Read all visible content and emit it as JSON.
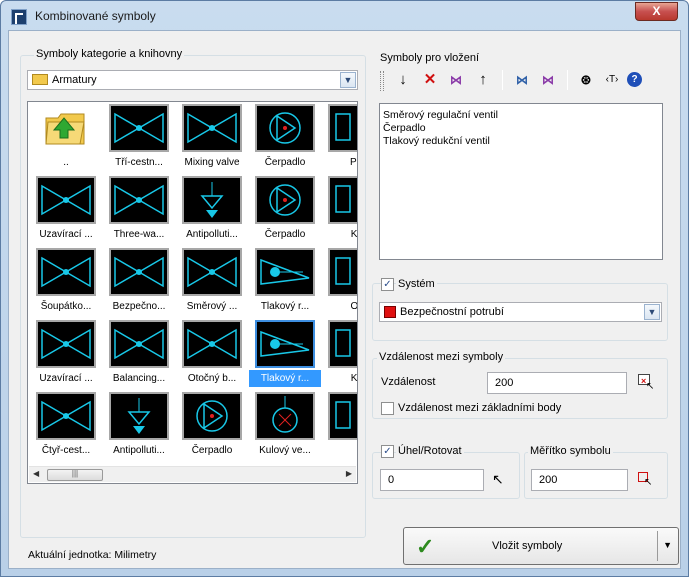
{
  "window": {
    "title": "Kombinované symboly",
    "close_label": "X"
  },
  "library": {
    "group_label": "Symboly kategorie a knihovny",
    "category_value": "Armatury",
    "items": [
      {
        "label": "..",
        "icon": "folder-up-icon"
      },
      {
        "label": "Tří-cestn...",
        "icon": "three-way-valve-icon"
      },
      {
        "label": "Mixing valve",
        "icon": "mixing-valve-icon"
      },
      {
        "label": "Čerpadlo",
        "icon": "pump-icon"
      },
      {
        "label": "Přír",
        "icon": "symbol-icon"
      },
      {
        "label": "Uzavírací ...",
        "icon": "shutoff-valve-icon"
      },
      {
        "label": "Three-wa...",
        "icon": "three-way-valve-icon"
      },
      {
        "label": "Antipolluti...",
        "icon": "antipollution-valve-icon"
      },
      {
        "label": "Čerpadlo",
        "icon": "pump-icon"
      },
      {
        "label": "Kul",
        "icon": "symbol-icon"
      },
      {
        "label": "Šoupátko...",
        "icon": "gate-valve-icon"
      },
      {
        "label": "Bezpečno...",
        "icon": "safety-valve-icon"
      },
      {
        "label": "Směrový ...",
        "icon": "directional-valve-icon"
      },
      {
        "label": "Tlakový r...",
        "icon": "pressure-valve-icon"
      },
      {
        "label": "Ovl",
        "icon": "symbol-icon"
      },
      {
        "label": "Uzavírací ...",
        "icon": "shutoff-valve-icon"
      },
      {
        "label": "Balancing...",
        "icon": "balancing-valve-icon"
      },
      {
        "label": "Otočný b...",
        "icon": "rotary-valve-icon"
      },
      {
        "label": "Tlakový r...",
        "icon": "pressure-valve-icon"
      },
      {
        "label": "Kal",
        "icon": "symbol-icon"
      },
      {
        "label": "Čtyř-cest...",
        "icon": "four-way-valve-icon"
      },
      {
        "label": "Antipolluti...",
        "icon": "antipollution-valve-icon"
      },
      {
        "label": "Čerpadlo",
        "icon": "pump-icon"
      },
      {
        "label": "Kulový ve...",
        "icon": "ball-valve-icon"
      },
      {
        "label": "",
        "icon": "symbol-icon"
      }
    ],
    "selected_index": 18
  },
  "insert": {
    "group_label": "Symboly pro vložení",
    "items": [
      "Směrový regulační ventil",
      "Čerpadlo",
      "Tlakový redukční ventil"
    ]
  },
  "system": {
    "checkbox_label": "Systém",
    "checked": true,
    "value": "Bezpečnostní potrubí",
    "color": "#e01010"
  },
  "distance": {
    "group_label": "Vzdálenost mezi symboly",
    "label": "Vzdálenost",
    "value": "200",
    "checkbox_label": "Vzdálenost mezi základními body",
    "checked": false
  },
  "rotation": {
    "checkbox_label": "Úhel/Rotovat",
    "checked": true,
    "value": "0"
  },
  "scale": {
    "group_label": "Měřítko symbolu",
    "value": "200"
  },
  "insert_button": {
    "label": "Vložit symboly"
  },
  "status": {
    "text": "Aktuální jednotka: Milimetry"
  }
}
